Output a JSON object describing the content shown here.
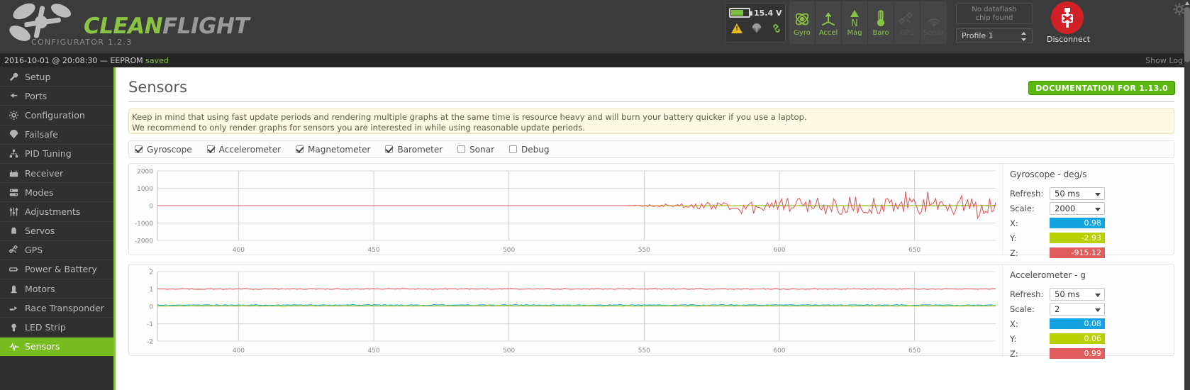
{
  "app": {
    "brand_primary": "CLEAN",
    "brand_secondary": "FLIGHT",
    "subtitle": "CONFIGURATOR  1.2.3",
    "accent_green": "#8ac445"
  },
  "header": {
    "battery": {
      "voltage": "15.4 V",
      "icon": "battery-icon"
    },
    "alert_icons": [
      "warning-triangle-icon",
      "parachute-icon",
      "link-icon"
    ],
    "sensors": [
      {
        "label": "Gyro",
        "icon": "gyro-icon",
        "active": true
      },
      {
        "label": "Accel",
        "icon": "accel-icon",
        "active": true
      },
      {
        "label": "Mag",
        "icon": "compass-icon",
        "active": true
      },
      {
        "label": "Baro",
        "icon": "thermometer-icon",
        "active": true
      },
      {
        "label": "GPS",
        "icon": "satellite-icon",
        "active": false
      },
      {
        "label": "Sonar",
        "icon": "sonar-icon",
        "active": false
      }
    ],
    "dataflash": "No dataflash\nchip found",
    "dataflash_line1": "No dataflash",
    "dataflash_line2": "chip found",
    "profile": "Profile 1",
    "disconnect_label": "Disconnect"
  },
  "statusbar": {
    "message": "2016-10-01 @ 20:08:30 — EEPROM ",
    "saved": "saved",
    "show_log": "Show Log"
  },
  "sidebar": {
    "items": [
      {
        "label": "Setup",
        "icon": "wrench-icon",
        "active": false
      },
      {
        "label": "Ports",
        "icon": "plug-icon",
        "active": false
      },
      {
        "label": "Configuration",
        "icon": "gear-icon",
        "active": false
      },
      {
        "label": "Failsafe",
        "icon": "parachute-icon",
        "active": false
      },
      {
        "label": "PID Tuning",
        "icon": "sliders-icon",
        "active": false
      },
      {
        "label": "Receiver",
        "icon": "transmitter-icon",
        "active": false
      },
      {
        "label": "Modes",
        "icon": "switches-icon",
        "active": false
      },
      {
        "label": "Adjustments",
        "icon": "faders-icon",
        "active": false
      },
      {
        "label": "Servos",
        "icon": "servo-icon",
        "active": false
      },
      {
        "label": "GPS",
        "icon": "satellite-icon",
        "active": false
      },
      {
        "label": "Power & Battery",
        "icon": "battery-icon",
        "active": false
      },
      {
        "label": "Motors",
        "icon": "motor-icon",
        "active": false
      },
      {
        "label": "Race Transponder",
        "icon": "transponder-icon",
        "active": false
      },
      {
        "label": "LED Strip",
        "icon": "led-icon",
        "active": false
      },
      {
        "label": "Sensors",
        "icon": "waveform-icon",
        "active": true
      }
    ]
  },
  "main": {
    "title": "Sensors",
    "doc_button": "DOCUMENTATION FOR 1.13.0",
    "note_line1": "Keep in mind that using fast update periods and rendering multiple graphs at the same time is resource heavy and will burn your battery quicker if you use a laptop.",
    "note_line2": "We recommend to only render graphs for sensors you are interested in while using reasonable update periods.",
    "checkboxes": [
      {
        "label": "Gyroscope",
        "checked": true
      },
      {
        "label": "Accelerometer",
        "checked": true
      },
      {
        "label": "Magnetometer",
        "checked": true
      },
      {
        "label": "Barometer",
        "checked": true
      },
      {
        "label": "Sonar",
        "checked": false
      },
      {
        "label": "Debug",
        "checked": false
      }
    ],
    "refresh_label": "Refresh:",
    "scale_label": "Scale:",
    "axis_x_label": "X:",
    "axis_y_label": "Y:",
    "axis_z_label": "Z:"
  },
  "chart_data": [
    {
      "type": "line",
      "title": "Gyroscope - deg/s",
      "refresh": "50 ms",
      "scale": "2000",
      "ylabel": "",
      "xlabel": "",
      "ylim": [
        -2000,
        2000
      ],
      "yticks": [
        "2000",
        "1000",
        "0",
        "-1000",
        "-2000"
      ],
      "xticks": [
        "400",
        "450",
        "500",
        "550",
        "600",
        "650"
      ],
      "xlim": [
        370,
        680
      ],
      "grid": true,
      "legend_position": "right-panel",
      "series": [
        {
          "name": "X",
          "color": "#12a3e0",
          "current_value": "0.98"
        },
        {
          "name": "Y",
          "color": "#b6d000",
          "current_value": "-2.93"
        },
        {
          "name": "Z",
          "color": "#e05d5d",
          "current_value": "-915.12"
        }
      ]
    },
    {
      "type": "line",
      "title": "Accelerometer - g",
      "refresh": "50 ms",
      "scale": "2",
      "ylabel": "",
      "xlabel": "",
      "ylim": [
        -2,
        2
      ],
      "yticks": [
        "2",
        "1",
        "0",
        "-1",
        "-2"
      ],
      "xticks": [
        "400",
        "450",
        "500",
        "550",
        "600",
        "650"
      ],
      "xlim": [
        370,
        680
      ],
      "grid": true,
      "legend_position": "right-panel",
      "series": [
        {
          "name": "X",
          "color": "#12a3e0",
          "current_value": "0.08"
        },
        {
          "name": "Y",
          "color": "#b6d000",
          "current_value": "0.06"
        },
        {
          "name": "Z",
          "color": "#e05d5d",
          "current_value": "0.99"
        }
      ]
    }
  ]
}
